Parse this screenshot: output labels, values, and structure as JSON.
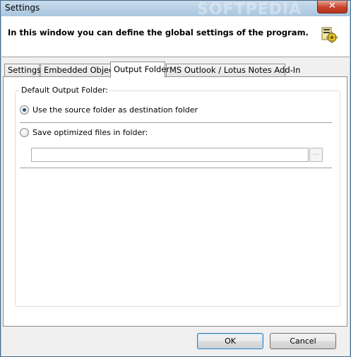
{
  "window": {
    "title": "Settings",
    "watermark": "SOFTPEDIA",
    "close_glyph": "✕"
  },
  "header": {
    "text": "In this window you can define the global settings of the program.",
    "icon": "settings-gear-icon"
  },
  "tabs": [
    {
      "label": "Settings",
      "active": false
    },
    {
      "label": "Embedded Objects",
      "active": false
    },
    {
      "label": "Output Folder",
      "active": true
    },
    {
      "label": "MS Outlook / Lotus Notes Add-In",
      "active": false
    }
  ],
  "output_folder": {
    "group_label": "Default Output Folder:",
    "option_source": {
      "label": "Use the source folder as destination folder",
      "checked": true
    },
    "option_custom": {
      "label": "Save optimized files in folder:",
      "checked": false
    },
    "path_value": "",
    "browse_label": "..."
  },
  "buttons": {
    "ok": "OK",
    "cancel": "Cancel"
  }
}
